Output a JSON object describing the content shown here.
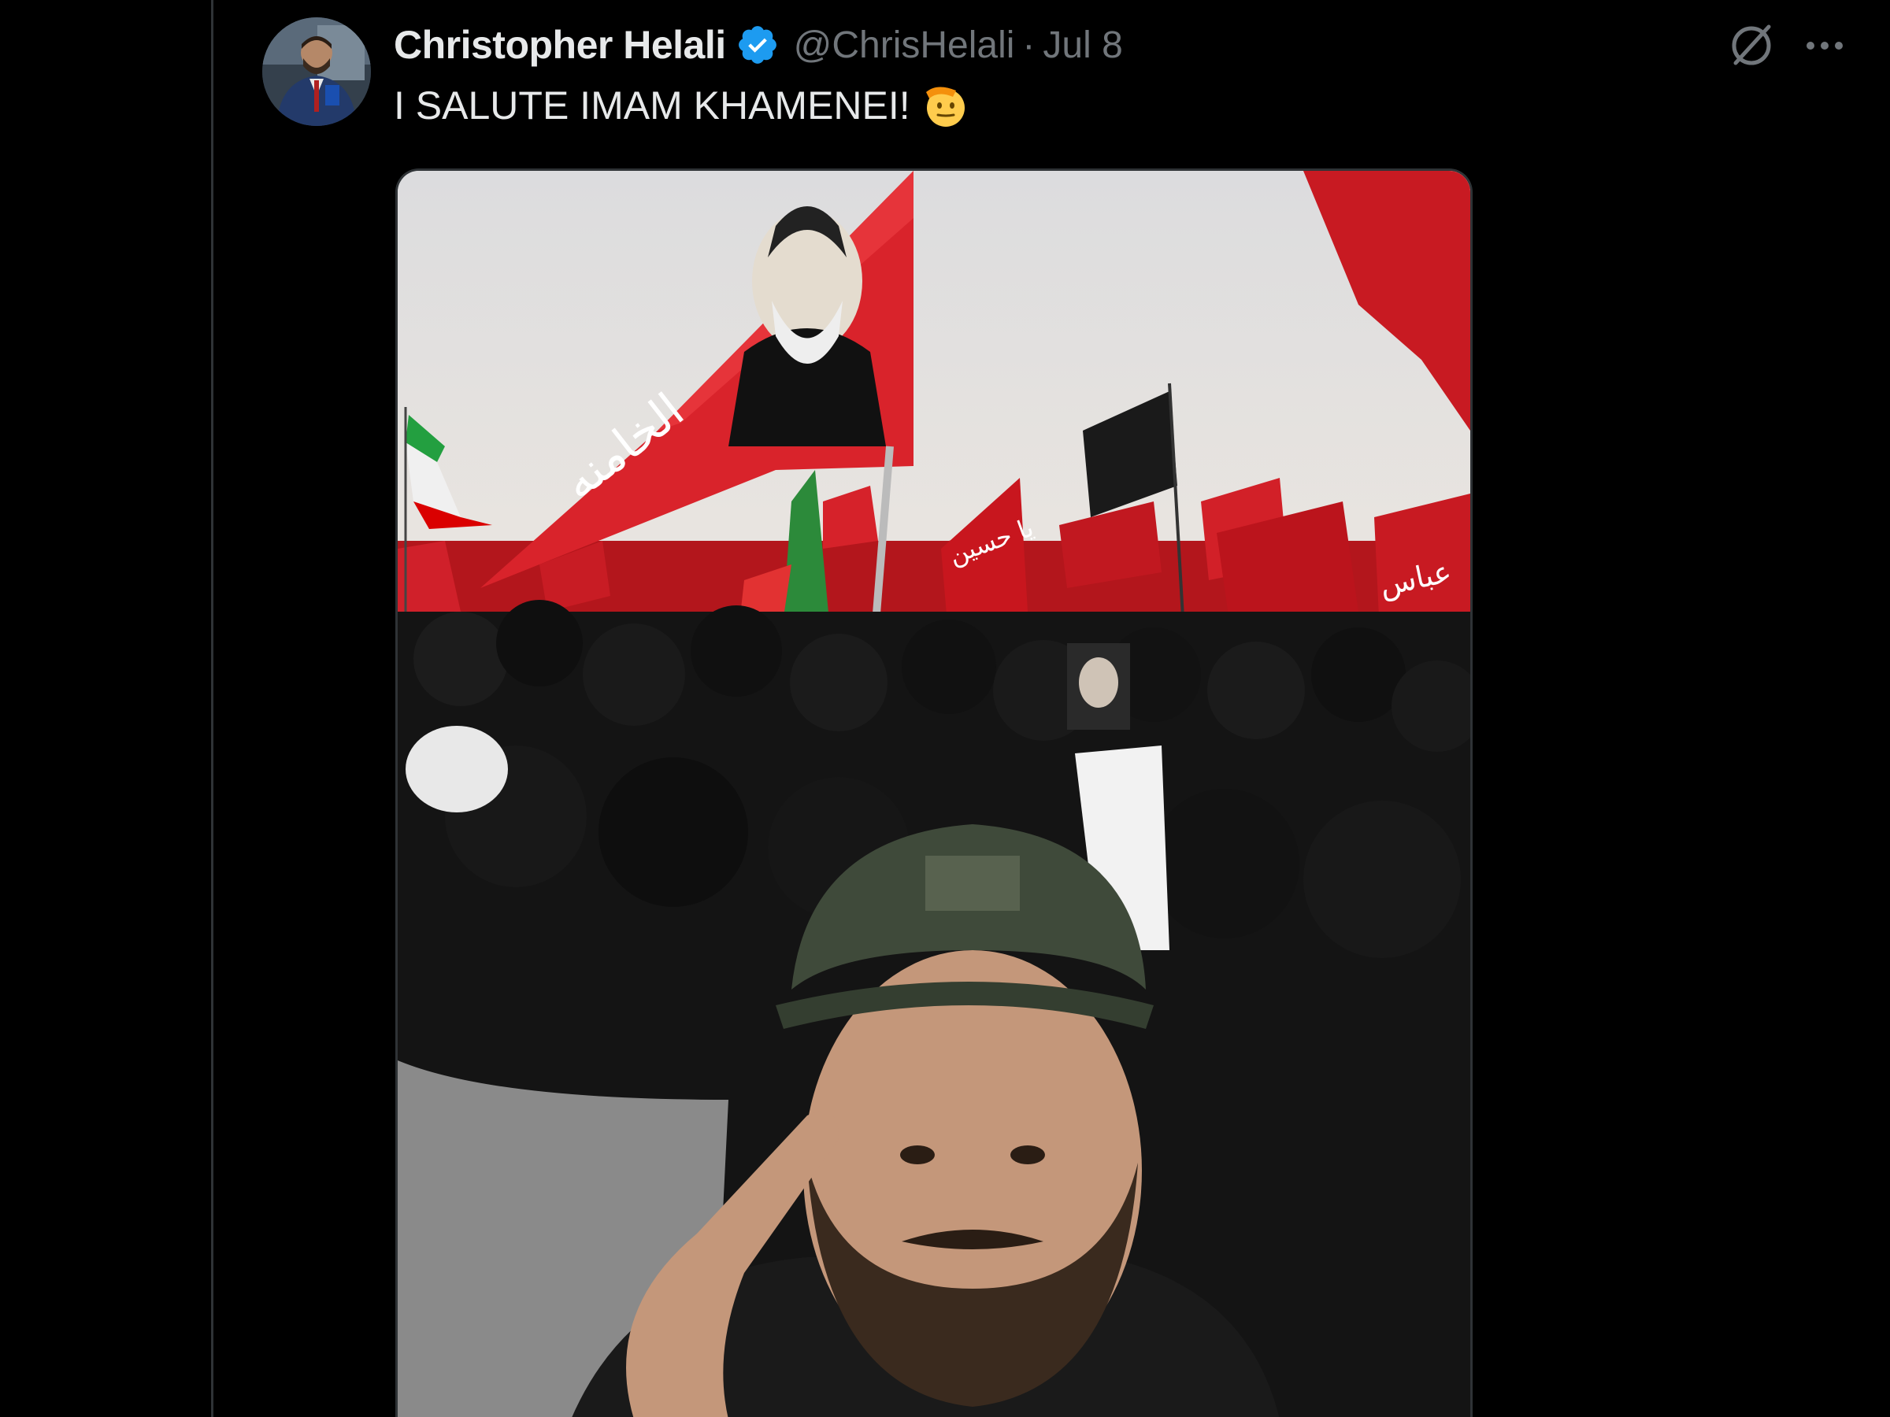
{
  "tweet": {
    "author": {
      "display_name": "Christopher Helali",
      "handle": "@ChrisHelali",
      "verified": true
    },
    "separator": "·",
    "date": "Jul 8",
    "text": "I SALUTE IMAM KHAMENEI!",
    "emoji": "saluting-face-icon"
  },
  "actions": {
    "grok_icon": "grok-icon",
    "more_icon": "more-options-icon"
  },
  "colors": {
    "background": "#000000",
    "text_primary": "#e7e9ea",
    "text_secondary": "#71767b",
    "verified_badge": "#1d9bf0",
    "border": "#2f3336"
  }
}
